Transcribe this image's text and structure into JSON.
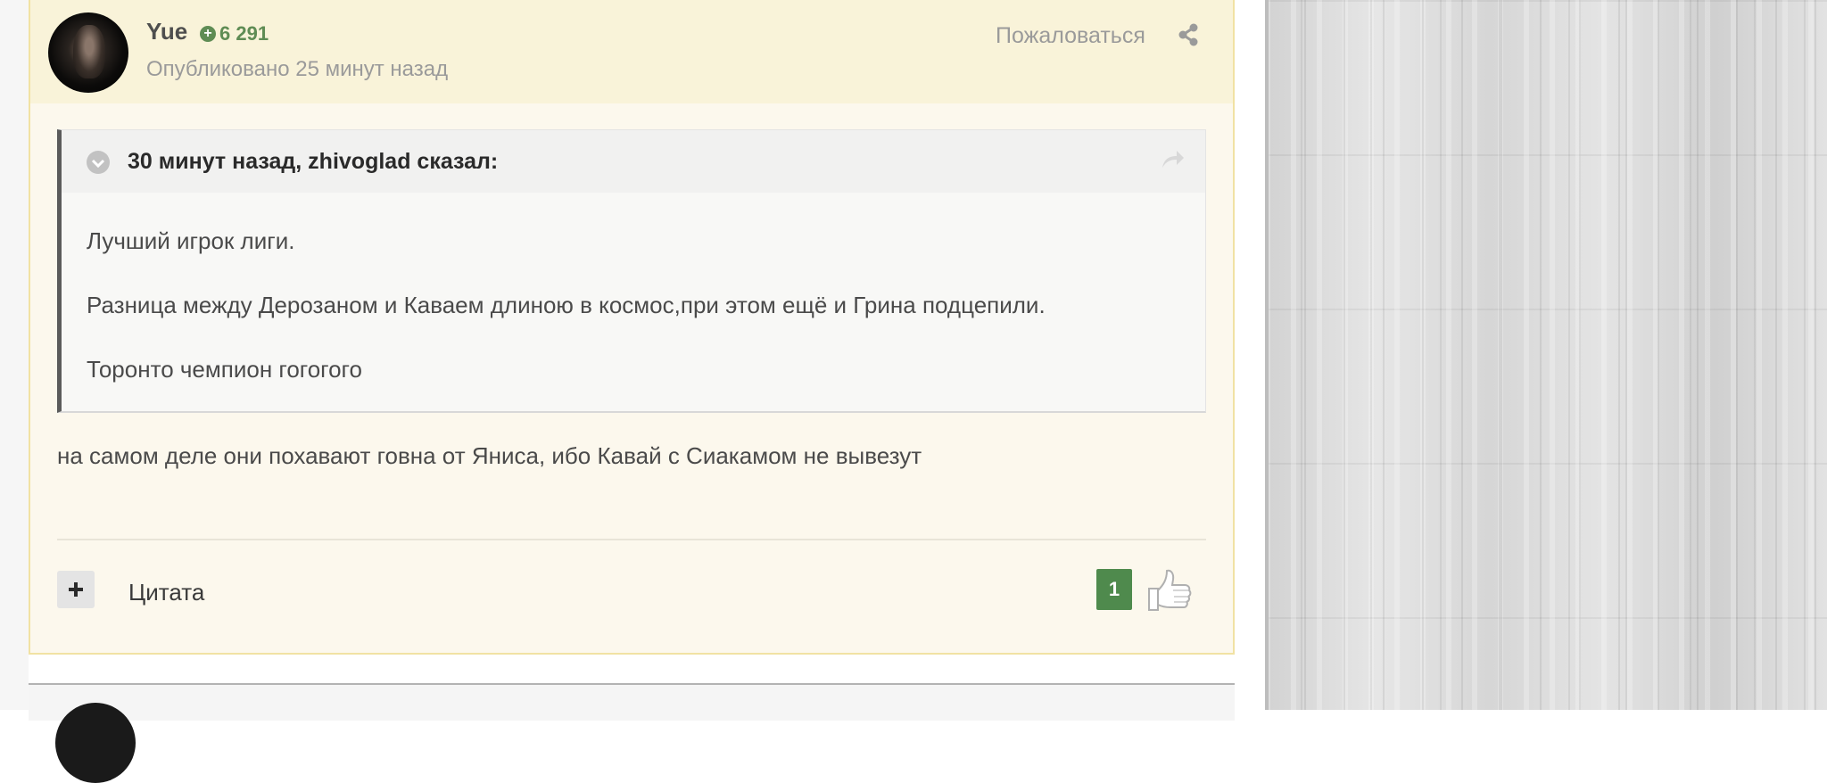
{
  "post": {
    "author": "Yue",
    "reputation": "6 291",
    "date": "Опубликовано 25 минут назад",
    "report_label": "Пожаловаться",
    "quote": {
      "citation": "30 минут назад, zhivoglad сказал:",
      "lines": [
        "Лучший игрок лиги.",
        "Разница между Дерозаном и Каваем длиною в космос,при этом ещё и Грина подцепили.",
        "Торонто чемпион гогогого"
      ]
    },
    "content": "на самом деле они похавают говна от Яниса, ибо Кавай с Сиакамом не вывезут",
    "quote_button_label": "Цитата",
    "like_count": "1"
  },
  "icons": {
    "reputation": "plus-circle-icon",
    "share": "share-icon",
    "quote_toggle": "chevron-down-icon",
    "quote_jump": "forward-arrow-icon",
    "multiquote": "plus-icon",
    "like": "thumbs-up-icon"
  },
  "colors": {
    "reputation_green": "#5f8c54",
    "like_badge": "#4f8a4d",
    "highlight_bg": "#fcf8ed",
    "highlight_border": "#f1e2a3"
  }
}
